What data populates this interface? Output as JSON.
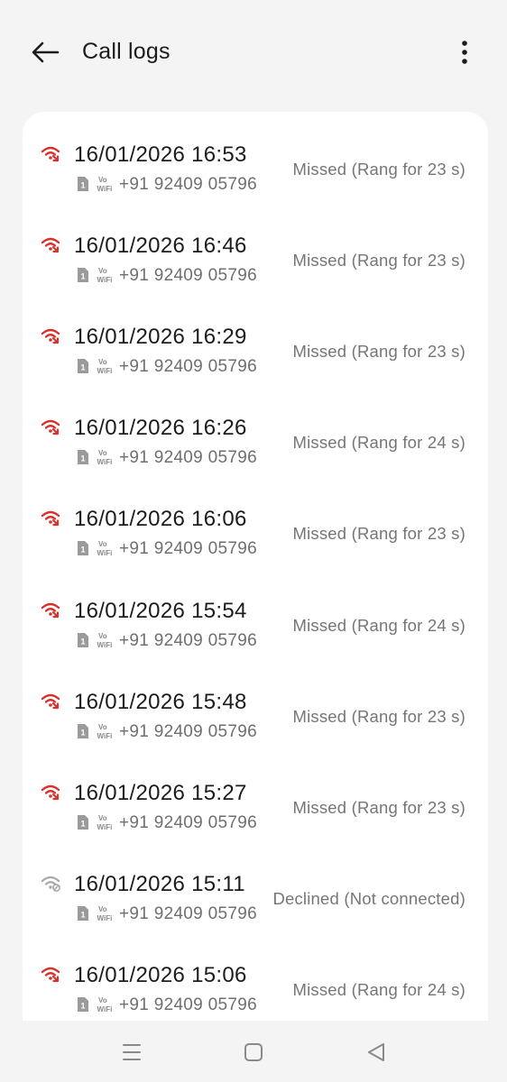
{
  "header": {
    "title": "Call logs",
    "back_icon": "arrow-left-icon",
    "more_icon": "more-vertical-icon"
  },
  "colors": {
    "missed": "#d8322c",
    "declined": "#a8a8a8",
    "background": "#f4f4f4",
    "card": "#ffffff"
  },
  "vowifi": {
    "top": "Vo",
    "bottom": "WiFi"
  },
  "sim_label": "1",
  "calls": [
    {
      "datetime": "16/01/2026 16:53",
      "number": "+91 92409 05796",
      "status": "Missed (Rang for 23 s)",
      "type": "missed"
    },
    {
      "datetime": "16/01/2026 16:46",
      "number": "+91 92409 05796",
      "status": "Missed (Rang for 23 s)",
      "type": "missed"
    },
    {
      "datetime": "16/01/2026 16:29",
      "number": "+91 92409 05796",
      "status": "Missed (Rang for 23 s)",
      "type": "missed"
    },
    {
      "datetime": "16/01/2026 16:26",
      "number": "+91 92409 05796",
      "status": "Missed (Rang for 24 s)",
      "type": "missed"
    },
    {
      "datetime": "16/01/2026 16:06",
      "number": "+91 92409 05796",
      "status": "Missed (Rang for 23 s)",
      "type": "missed"
    },
    {
      "datetime": "16/01/2026 15:54",
      "number": "+91 92409 05796",
      "status": "Missed (Rang for 24 s)",
      "type": "missed"
    },
    {
      "datetime": "16/01/2026 15:48",
      "number": "+91 92409 05796",
      "status": "Missed (Rang for 23 s)",
      "type": "missed"
    },
    {
      "datetime": "16/01/2026 15:27",
      "number": "+91 92409 05796",
      "status": "Missed (Rang for 23 s)",
      "type": "missed"
    },
    {
      "datetime": "16/01/2026 15:11",
      "number": "+91 92409 05796",
      "status": "Declined (Not connected)",
      "type": "declined"
    },
    {
      "datetime": "16/01/2026 15:06",
      "number": "+91 92409 05796",
      "status": "Missed (Rang for 24 s)",
      "type": "missed"
    }
  ],
  "nav": {
    "recents_icon": "menu-lines-icon",
    "home_icon": "square-home-icon",
    "back_icon": "triangle-back-icon"
  }
}
